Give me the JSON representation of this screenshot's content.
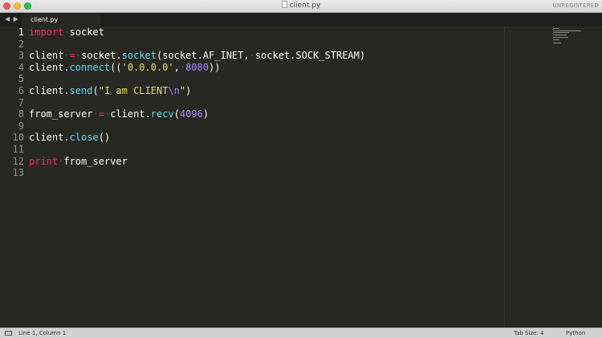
{
  "window": {
    "title": "client.py",
    "license_status": "UNREGISTERED"
  },
  "tabbar": {
    "nav_arrows": "◀ ▶",
    "active_tab": "client.py"
  },
  "editor": {
    "line_numbers": [
      "1",
      "2",
      "3",
      "4",
      "5",
      "6",
      "7",
      "8",
      "9",
      "10",
      "11",
      "12",
      "13"
    ],
    "active_line": 1,
    "code_lines": [
      "import socket",
      "",
      "client = socket.socket(socket.AF_INET, socket.SOCK_STREAM)",
      "client.connect(('0.0.0.0', 8080))",
      "",
      "client.send(\"I am CLIENT\\n\")",
      "",
      "from_server = client.recv(4096)",
      "",
      "client.close()",
      "",
      "print from_server",
      ""
    ]
  },
  "statusbar": {
    "position": "Line 1, Column 1",
    "tab_size": "Tab Size: 4",
    "syntax": "Python"
  },
  "colors": {
    "background": "#272822",
    "keyword": "#f92672",
    "function": "#66d9ef",
    "string": "#e6db74",
    "number": "#ae81ff",
    "text": "#f8f8f2"
  }
}
